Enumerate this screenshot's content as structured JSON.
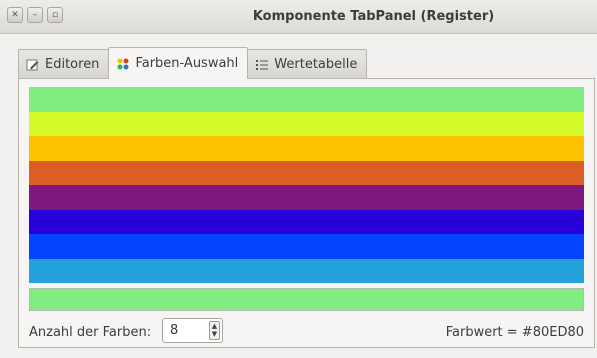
{
  "window": {
    "title": "Komponente TabPanel (Register)",
    "controls": [
      "close-icon",
      "minimize-icon",
      "maximize-icon"
    ]
  },
  "tabs": [
    {
      "label": "Editoren",
      "icon": "edit-icon",
      "active": false
    },
    {
      "label": "Farben-Auswahl",
      "icon": "color-palette-icon",
      "active": true
    },
    {
      "label": "Wertetabelle",
      "icon": "list-icon",
      "active": false
    }
  ],
  "colors": {
    "bands": [
      "#80ED80",
      "#D4FC2A",
      "#FEC200",
      "#DA5E26",
      "#7E187F",
      "#2800D8",
      "#0244FF",
      "#24A0DB"
    ],
    "selected": "#80ED80"
  },
  "footer": {
    "count_label": "Anzahl der Farben:",
    "count_value": "8",
    "value_text": "Farbwert = #80ED80"
  }
}
